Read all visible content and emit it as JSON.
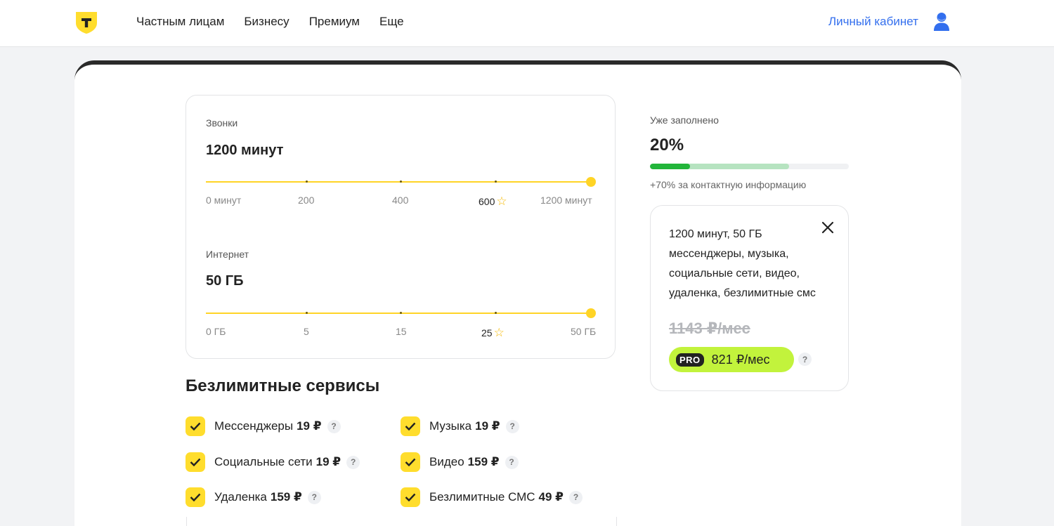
{
  "header": {
    "nav": [
      "Частным лицам",
      "Бизнесу",
      "Премиум",
      "Еще"
    ],
    "cabinet_label": "Личный кабинет"
  },
  "calls": {
    "label": "Звонки",
    "value": "1200 минут",
    "ticks": [
      "0 минут",
      "200",
      "400",
      "600",
      "1200 минут"
    ],
    "recommended_tick": "600",
    "selected_fraction": 1.0
  },
  "internet": {
    "label": "Интернет",
    "value": "50 ГБ",
    "ticks": [
      "0 ГБ",
      "5",
      "15",
      "25",
      "50 ГБ"
    ],
    "recommended_tick": "25",
    "selected_fraction": 1.0
  },
  "services": {
    "title": "Безлимитные сервисы",
    "items": [
      {
        "name": "Мессенджеры",
        "price": "19 ₽",
        "checked": true
      },
      {
        "name": "Музыка",
        "price": "19 ₽",
        "checked": true
      },
      {
        "name": "Социальные сети",
        "price": "19 ₽",
        "checked": true
      },
      {
        "name": "Видео",
        "price": "159 ₽",
        "checked": true
      },
      {
        "name": "Удаленка",
        "price": "159 ₽",
        "checked": true
      },
      {
        "name": "Безлимитные СМС",
        "price": "49 ₽",
        "checked": true
      }
    ]
  },
  "profile": {
    "label": "Уже заполнено",
    "value": "20%",
    "progress_fraction": 0.2,
    "potential_fraction": 0.7,
    "hint": "+70% за контактную информацию"
  },
  "summary": {
    "lines": [
      "1200 минут, 50 ГБ",
      "мессенджеры, музыка,",
      "социальные сети, видео,",
      "удаленка, безлимитные смс"
    ],
    "old_price": "1143 ₽/мес",
    "pro_badge": "PRO",
    "pro_price": "821 ₽/мес"
  },
  "help_mark": "?",
  "colors": {
    "accent_yellow": "#ffdd2d",
    "link_blue": "#336fee",
    "progress_green": "#22b53a",
    "pro_green": "#c2f33c"
  }
}
